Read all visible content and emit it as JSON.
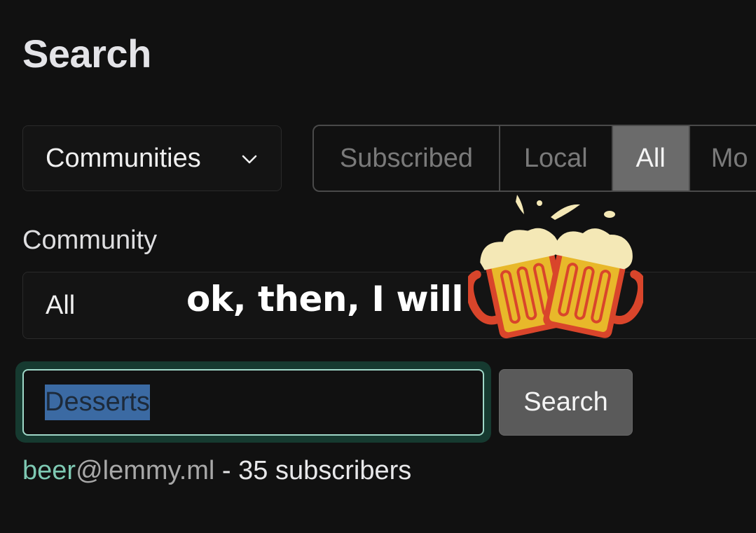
{
  "page": {
    "title": "Search"
  },
  "filters": {
    "type_select": {
      "value": "Communities",
      "icon": "chevron-down-icon"
    },
    "listing_tabs": [
      {
        "label": "Subscribed",
        "active": false
      },
      {
        "label": "Local",
        "active": false
      },
      {
        "label": "All",
        "active": true
      },
      {
        "label": "Mo",
        "active": false
      }
    ],
    "community_label": "Community",
    "community_select": {
      "value": "All"
    }
  },
  "overlay": {
    "caption": "ok, then, I will",
    "sticker": "beer-mugs-cheers-icon"
  },
  "search": {
    "input_value": "Desserts",
    "button_label": "Search"
  },
  "results": [
    {
      "name": "beer",
      "instance": "@lemmy.ml",
      "separator": " - ",
      "subscribers": "35 subscribers"
    }
  ],
  "colors": {
    "background": "#111111",
    "accent_green": "#7ec9b3",
    "focus_ring": "#9fd8c8",
    "active_tab": "#6b6b6b",
    "selection": "#3b6aa3",
    "beer_orange": "#d9452b",
    "beer_gold": "#e8b82a",
    "foam": "#f4e8b6"
  }
}
